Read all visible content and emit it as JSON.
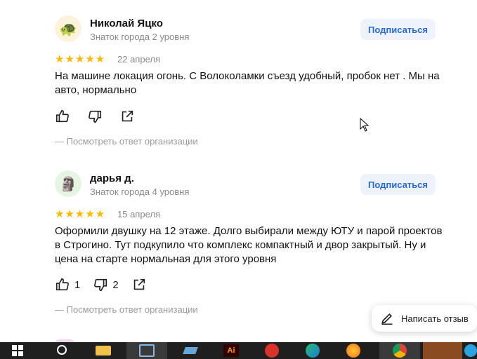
{
  "reviews": [
    {
      "name": "Николай Яцко",
      "level": "Знаток города 2 уровня",
      "subscribe": "Подписаться",
      "stars": "★★★★★",
      "date": "22 апреля",
      "text": "На машине локация огонь. С Волоколамки съезд удобный, пробок нет . Мы на авто, нормально",
      "likes": "",
      "dislikes": "",
      "reply_link": "— Посмотреть ответ организации",
      "avatar_icon": "turtle-icon",
      "avatar_bg": "#fdf3dc"
    },
    {
      "name": "дарья д.",
      "level": "Знаток города 4 уровня",
      "subscribe": "Подписаться",
      "stars": "★★★★★",
      "date": "15 апреля",
      "text": "Оформили двушку на 12 этаже. Долго выбирали между ЮТУ и парой проектов в Строгино. Тут подкупило что комплекс компактный и двор закрытый. Ну и цена на старте нормальная для этого уровня",
      "likes": "1",
      "dislikes": "2",
      "reply_link": "— Посмотреть ответ организации",
      "avatar_icon": "moai-icon",
      "avatar_bg": "#e6f5e3"
    }
  ],
  "write_review": "Написать отзыв",
  "colors": {
    "accent": "#2a6ad4",
    "star": "#ffb800",
    "taskbar": "#1f1f1f"
  },
  "taskbar_icons": [
    "windows-start-icon",
    "search-icon",
    "file-explorer-icon",
    "task-manager-icon",
    "app-icon",
    "illustrator-icon",
    "app-red-icon",
    "edge-icon",
    "firefox-icon",
    "chrome-icon",
    "app-brown-icon",
    "telegram-icon"
  ]
}
